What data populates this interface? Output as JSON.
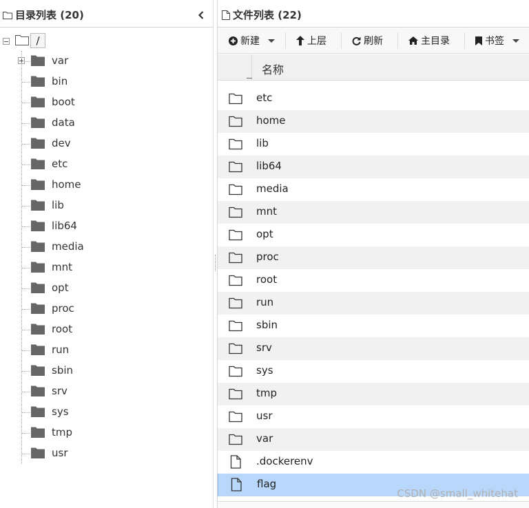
{
  "left_panel": {
    "title": "目录列表 (20)",
    "root_label": "/",
    "items": [
      {
        "label": "var",
        "expandable": true
      },
      {
        "label": "bin"
      },
      {
        "label": "boot"
      },
      {
        "label": "data"
      },
      {
        "label": "dev"
      },
      {
        "label": "etc"
      },
      {
        "label": "home"
      },
      {
        "label": "lib"
      },
      {
        "label": "lib64"
      },
      {
        "label": "media"
      },
      {
        "label": "mnt"
      },
      {
        "label": "opt"
      },
      {
        "label": "proc"
      },
      {
        "label": "root"
      },
      {
        "label": "run"
      },
      {
        "label": "sbin"
      },
      {
        "label": "srv"
      },
      {
        "label": "sys"
      },
      {
        "label": "tmp"
      },
      {
        "label": "usr"
      }
    ]
  },
  "right_panel": {
    "title": "文件列表 (22)",
    "toolbar": {
      "new_label": "新建",
      "up_label": "上层",
      "refresh_label": "刷新",
      "home_label": "主目录",
      "bookmark_label": "书签"
    },
    "column_name": "名称",
    "rows": [
      {
        "name": "etc",
        "type": "folder"
      },
      {
        "name": "home",
        "type": "folder"
      },
      {
        "name": "lib",
        "type": "folder"
      },
      {
        "name": "lib64",
        "type": "folder"
      },
      {
        "name": "media",
        "type": "folder"
      },
      {
        "name": "mnt",
        "type": "folder"
      },
      {
        "name": "opt",
        "type": "folder"
      },
      {
        "name": "proc",
        "type": "folder"
      },
      {
        "name": "root",
        "type": "folder"
      },
      {
        "name": "run",
        "type": "folder"
      },
      {
        "name": "sbin",
        "type": "folder"
      },
      {
        "name": "srv",
        "type": "folder"
      },
      {
        "name": "sys",
        "type": "folder"
      },
      {
        "name": "tmp",
        "type": "folder"
      },
      {
        "name": "usr",
        "type": "folder"
      },
      {
        "name": "var",
        "type": "folder"
      },
      {
        "name": ".dockerenv",
        "type": "file"
      },
      {
        "name": "flag",
        "type": "file",
        "selected": true
      }
    ]
  },
  "watermark": "CSDN @small_whitehat",
  "colors": {
    "selected_row": "#b9d7fb",
    "alt_row": "#f1f1f1",
    "folder_fill": "#666666"
  }
}
